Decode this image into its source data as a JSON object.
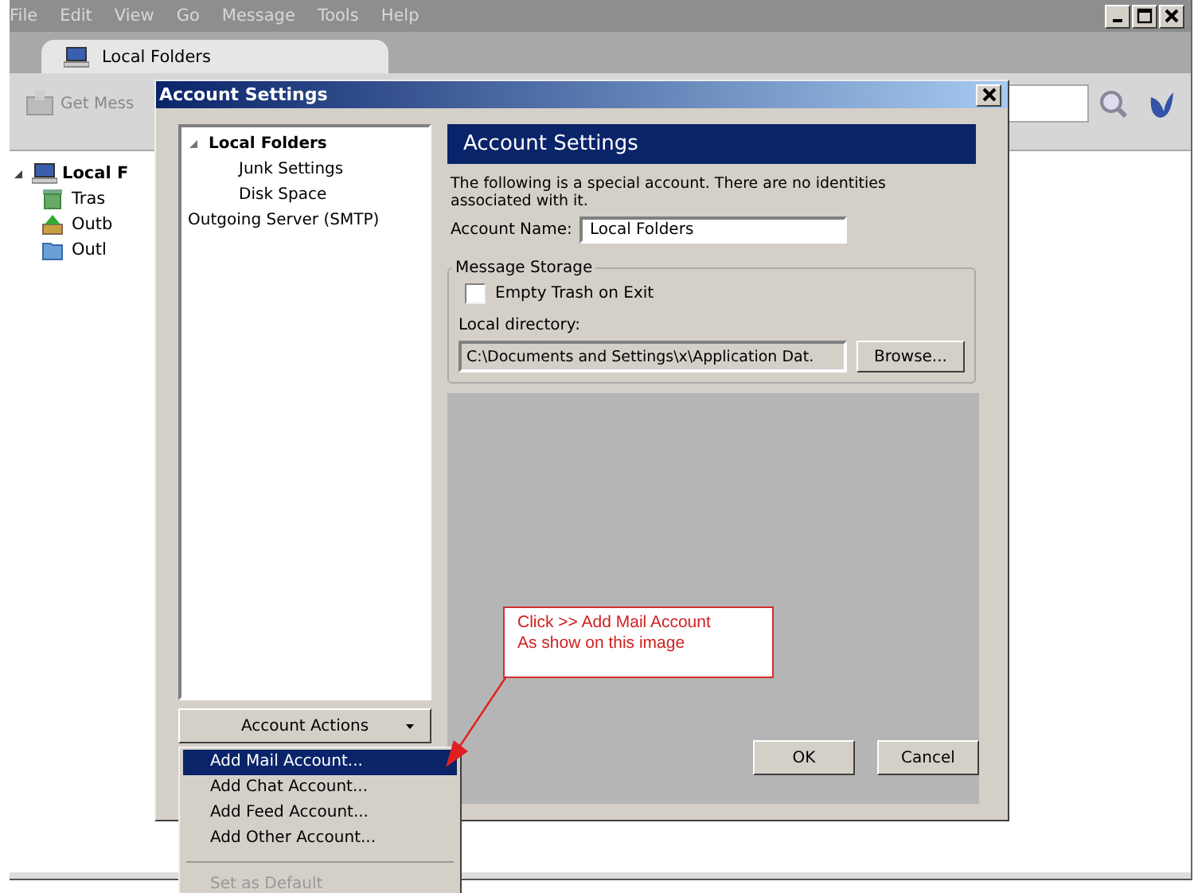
{
  "menu_bar": [
    "File",
    "Edit",
    "View",
    "Go",
    "Message",
    "Tools",
    "Help"
  ],
  "tab": {
    "label": "Local Folders"
  },
  "toolbar": {
    "get_messages": "Get Mess"
  },
  "folders": [
    {
      "label": "Local F",
      "kind": "account",
      "expanded": true,
      "children": [
        {
          "label": "Tras",
          "kind": "trash"
        },
        {
          "label": "Outb",
          "kind": "outbox"
        },
        {
          "label": "Outl",
          "kind": "folder"
        }
      ]
    }
  ],
  "dialog": {
    "title": "Account Settings",
    "tree": [
      {
        "label": "Local Folders",
        "expanded": true,
        "children": [
          {
            "label": "Junk Settings"
          },
          {
            "label": "Disk Space"
          }
        ]
      },
      {
        "label": "Outgoing Server (SMTP)"
      }
    ],
    "account_actions": "Account Actions",
    "header": "Account Settings",
    "description": "The following is a special account. There are no identities associated with it.",
    "account_name_label": "Account Name:",
    "account_name": "Local Folders",
    "storage_title": "Message Storage",
    "empty_trash": {
      "label": "Empty Trash on Exit",
      "checked": false
    },
    "local_dir_label": "Local directory:",
    "local_dir": "C:\\Documents and Settings\\x\\Application Dat.",
    "browse": "Browse...",
    "buttons": [
      "OK",
      "Cancel"
    ]
  },
  "actions_menu": [
    {
      "kind": "item",
      "label": "Add Mail Account...",
      "selected": true,
      "disabled": false
    },
    {
      "kind": "item",
      "label": "Add Chat Account...",
      "selected": false,
      "disabled": false
    },
    {
      "kind": "item",
      "label": "Add Feed Account...",
      "selected": false,
      "disabled": false
    },
    {
      "kind": "item",
      "label": "Add Other Account...",
      "selected": false,
      "disabled": false
    },
    {
      "kind": "separator"
    },
    {
      "kind": "item",
      "label": "Set as Default",
      "selected": false,
      "disabled": true
    }
  ],
  "callout": {
    "lines": [
      "Click >> Add Mail Account",
      "As show on this image"
    ]
  }
}
